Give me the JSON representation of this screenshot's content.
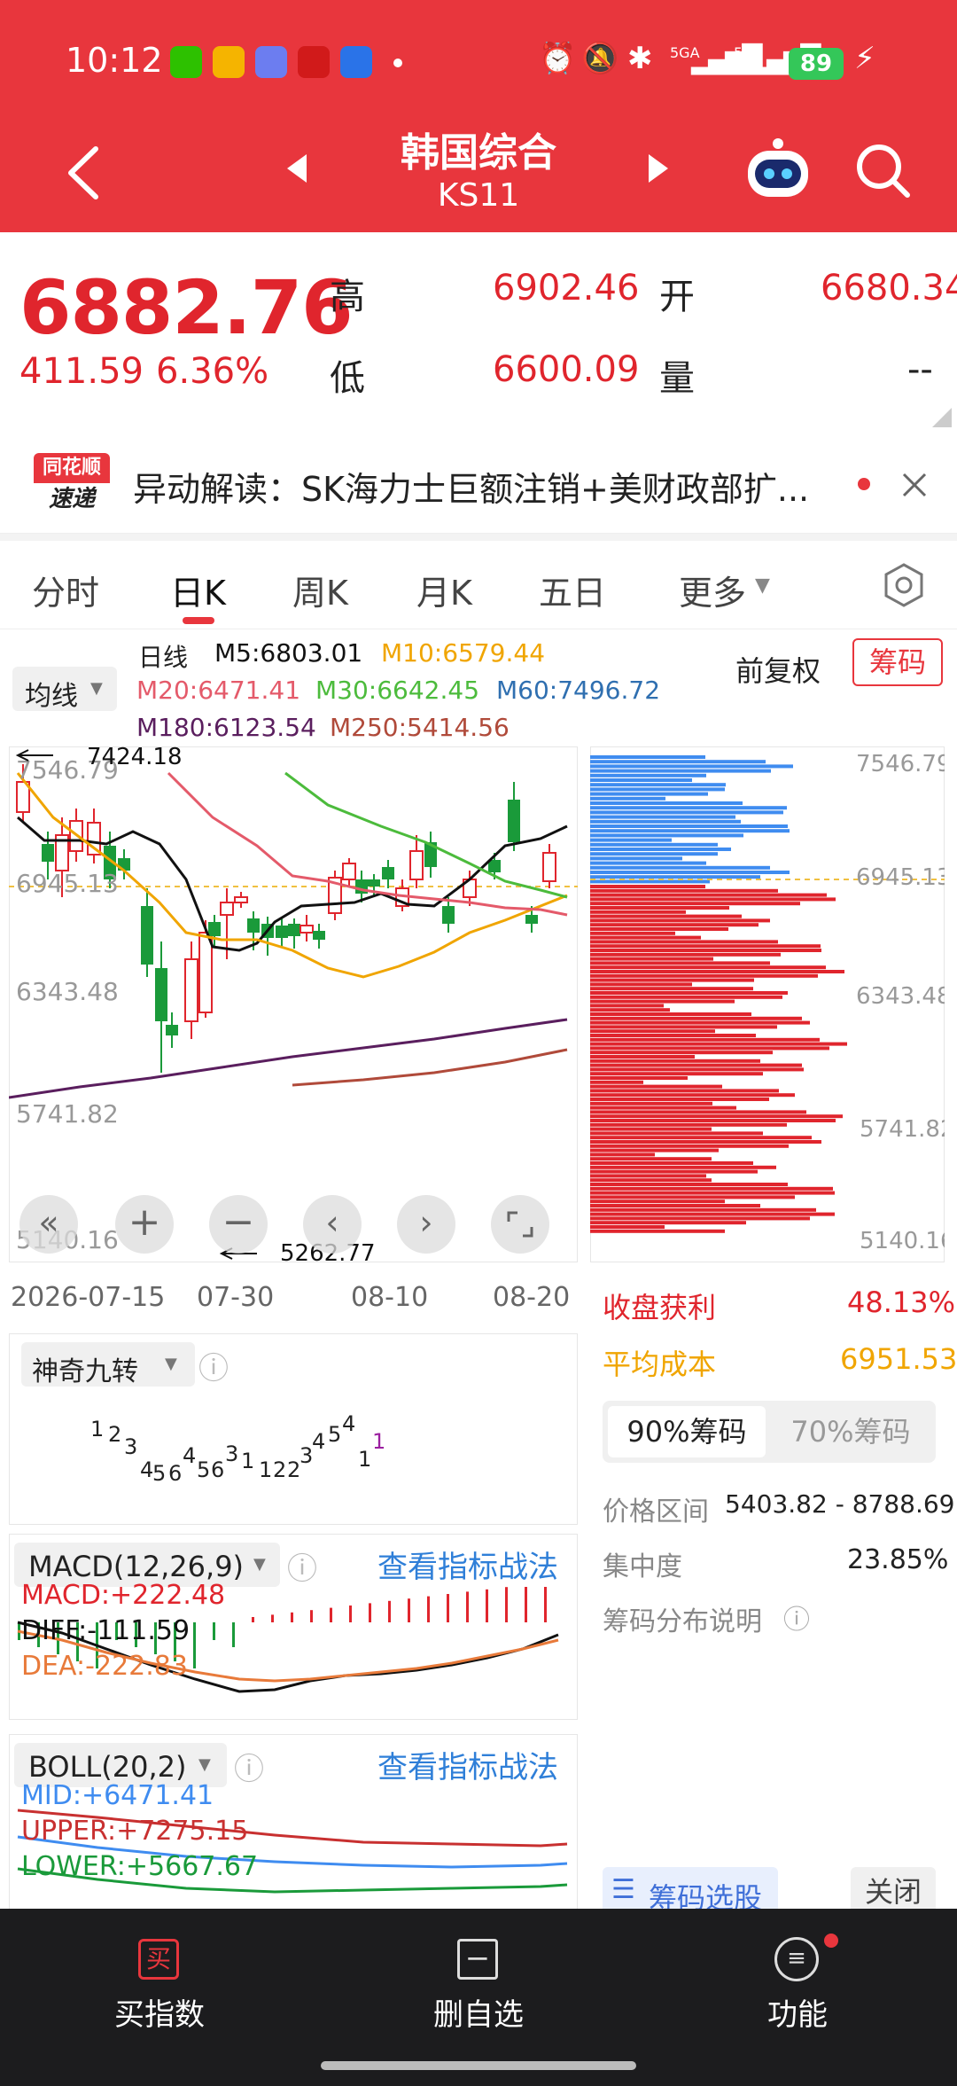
{
  "status_bar": {
    "time": "10:12",
    "network_1": "5GA",
    "network_2": "5G",
    "battery": "89"
  },
  "title_bar": {
    "title": "韩国综合",
    "code": "KS11"
  },
  "quote": {
    "price": "6882.76",
    "change": "411.59",
    "change_pct": "6.36%",
    "high_label": "高",
    "high": "6902.46",
    "open_label": "开",
    "open": "6680.34",
    "low_label": "低",
    "low": "6600.09",
    "volume_label": "量",
    "volume": "--"
  },
  "news": {
    "brand_top": "同花顺",
    "brand_bottom": "速递",
    "text": "异动解读：SK海力士巨额注销+美财政部扩..."
  },
  "tabs": [
    "分时",
    "日K",
    "周K",
    "月K",
    "五日",
    "更多"
  ],
  "chart_header": {
    "ma_selector": "均线",
    "period": "日线",
    "m5": "M5:6803.01",
    "m10": "M10:6579.44",
    "m20": "M20:6471.41",
    "m30": "M30:6642.45",
    "m60": "M60:7496.72",
    "m180": "M180:6123.54",
    "m250": "M250:5414.56",
    "adjust": "前复权",
    "chip_button": "筹码"
  },
  "kline": {
    "y_labels": [
      "7546.79",
      "6945.13",
      "6343.48",
      "5741.82",
      "5140.16"
    ],
    "max_marker": "7424.18",
    "min_marker": "5262.77",
    "x_labels": [
      "2026-07-15",
      "07-30",
      "08-10",
      "08-20"
    ]
  },
  "chip": {
    "profit_label": "收盘获利",
    "profit": "48.13%",
    "avg_cost_label": "平均成本",
    "avg_cost": "6951.53",
    "tab_90": "90%筹码",
    "tab_70": "70%筹码",
    "range_label": "价格区间",
    "range": "5403.82 - 8788.69",
    "concentration_label": "集中度",
    "concentration": "23.85%",
    "explain": "筹码分布说明",
    "select_stock": "筹码选股",
    "close": "关闭"
  },
  "nine": {
    "title": "神奇九转"
  },
  "macd": {
    "title": "MACD(12,26,9)",
    "link": "查看指标战法",
    "macd": "MACD:+222.48",
    "diff": "DIFF:-111.59",
    "dea": "DEA:-222.83"
  },
  "boll": {
    "title": "BOLL(20,2)",
    "link": "查看指标战法",
    "mid": "MID:+6471.41",
    "upper": "UPPER:+7275.15",
    "lower": "LOWER:+5667.67"
  },
  "bottom_nav": {
    "buy": "买指数",
    "buy_icon": "买",
    "remove": "删自选",
    "func": "功能"
  },
  "colors": {
    "brand_red": "#e8363d",
    "up_red": "#e0252d",
    "down_green": "#1a9a3a",
    "chip_blue": "#3f8cf0",
    "m5": "#111111",
    "m10": "#f0a500",
    "m20": "#e45a6a",
    "m30": "#4cbb3c",
    "m60": "#2f6fb0",
    "m180": "#5a1e5e",
    "m250": "#b04a3a"
  }
}
